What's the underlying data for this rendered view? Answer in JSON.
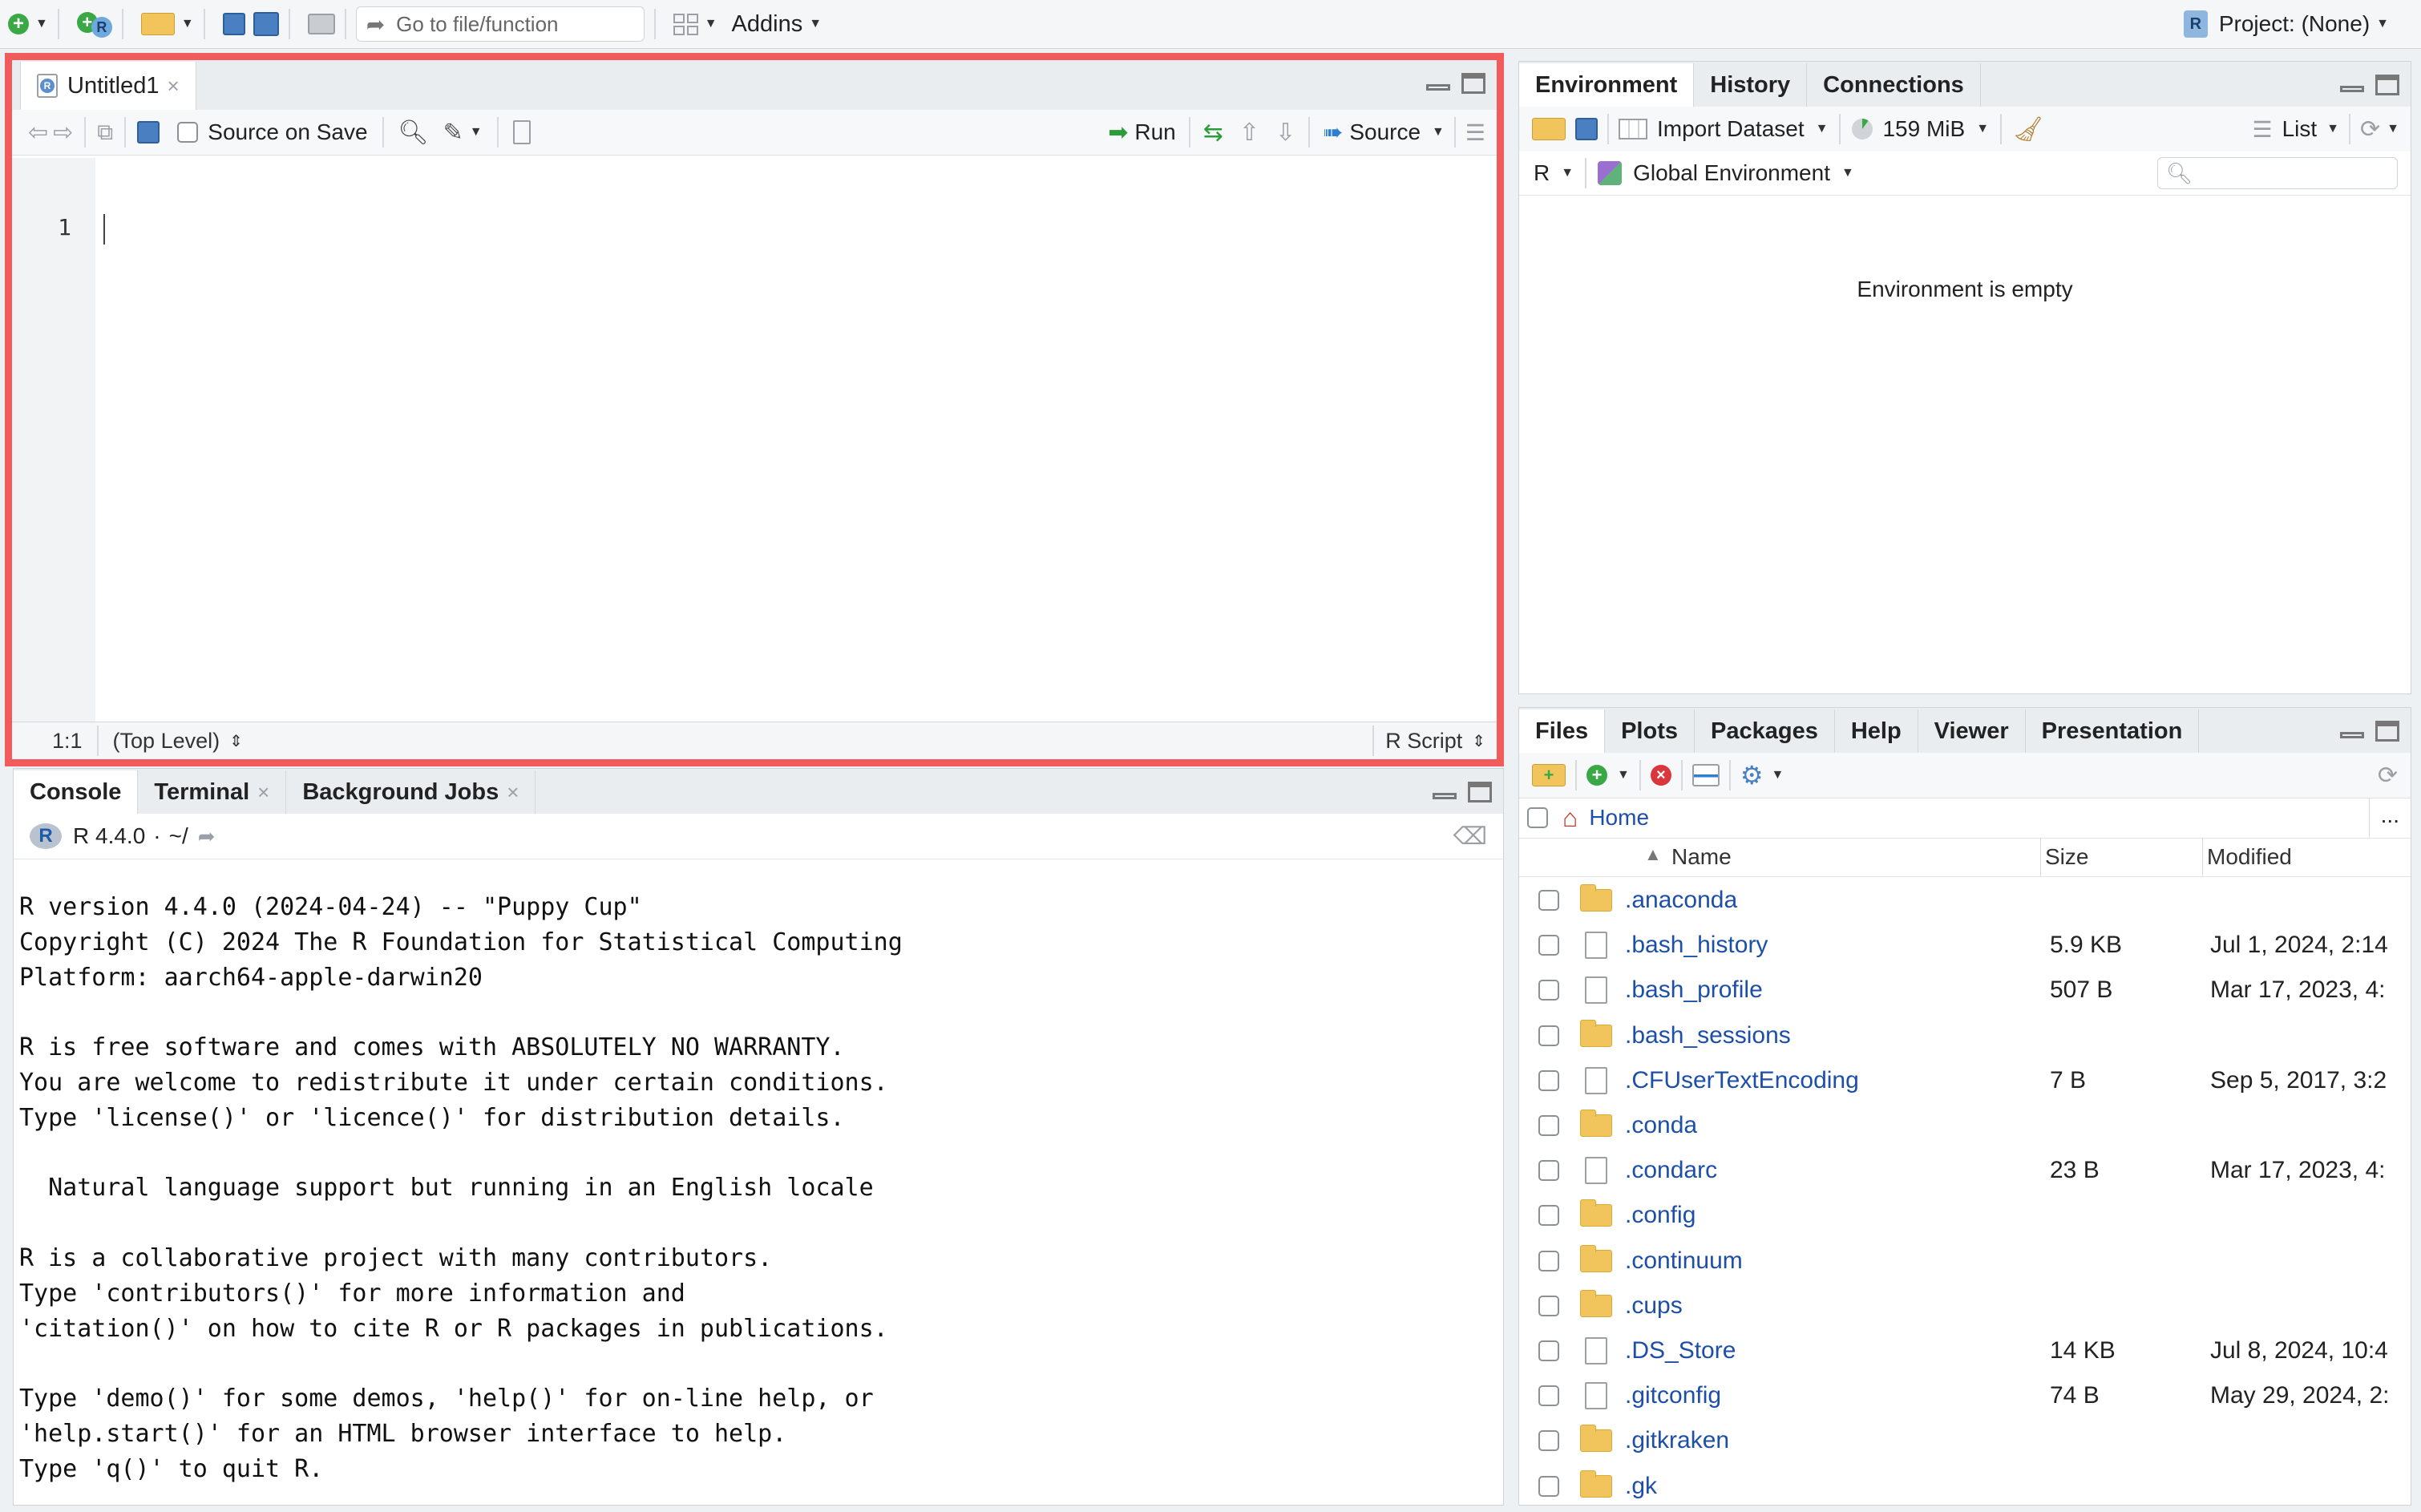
{
  "toolbar": {
    "goto_placeholder": "Go to file/function",
    "addins_label": "Addins",
    "project_label": "Project: (None)"
  },
  "editor": {
    "tab_label": "Untitled1",
    "source_on_save": "Source on Save",
    "run_label": "Run",
    "source_label": "Source",
    "line_number": "1",
    "cursor_pos": "1:1",
    "scope": "(Top Level)",
    "file_type": "R Script"
  },
  "console": {
    "tabs": [
      "Console",
      "Terminal",
      "Background Jobs"
    ],
    "r_version_label": "R 4.4.0",
    "path_label": "~/",
    "lines": [
      "R version 4.4.0 (2024-04-24) -- \"Puppy Cup\"",
      "Copyright (C) 2024 The R Foundation for Statistical Computing",
      "Platform: aarch64-apple-darwin20",
      "",
      "R is free software and comes with ABSOLUTELY NO WARRANTY.",
      "You are welcome to redistribute it under certain conditions.",
      "Type 'license()' or 'licence()' for distribution details.",
      "",
      "  Natural language support but running in an English locale",
      "",
      "R is a collaborative project with many contributors.",
      "Type 'contributors()' for more information and",
      "'citation()' on how to cite R or R packages in publications.",
      "",
      "Type 'demo()' for some demos, 'help()' for on-line help, or",
      "'help.start()' for an HTML browser interface to help.",
      "Type 'q()' to quit R."
    ]
  },
  "environment": {
    "tabs": [
      "Environment",
      "History",
      "Connections"
    ],
    "import_dataset": "Import Dataset",
    "memory": "159 MiB",
    "view_mode": "List",
    "language": "R",
    "scope": "Global Environment",
    "empty_message": "Environment is empty"
  },
  "files": {
    "tabs": [
      "Files",
      "Plots",
      "Packages",
      "Help",
      "Viewer",
      "Presentation"
    ],
    "breadcrumb": "Home",
    "more": "...",
    "columns": {
      "name": "Name",
      "size": "Size",
      "modified": "Modified"
    },
    "rows": [
      {
        "name": ".anaconda",
        "type": "folder",
        "size": "",
        "modified": ""
      },
      {
        "name": ".bash_history",
        "type": "file",
        "size": "5.9 KB",
        "modified": "Jul 1, 2024, 2:14"
      },
      {
        "name": ".bash_profile",
        "type": "file",
        "size": "507 B",
        "modified": "Mar 17, 2023, 4:"
      },
      {
        "name": ".bash_sessions",
        "type": "folder",
        "size": "",
        "modified": ""
      },
      {
        "name": ".CFUserTextEncoding",
        "type": "file",
        "size": "7 B",
        "modified": "Sep 5, 2017, 3:2"
      },
      {
        "name": ".conda",
        "type": "folder",
        "size": "",
        "modified": ""
      },
      {
        "name": ".condarc",
        "type": "file",
        "size": "23 B",
        "modified": "Mar 17, 2023, 4:"
      },
      {
        "name": ".config",
        "type": "folder",
        "size": "",
        "modified": ""
      },
      {
        "name": ".continuum",
        "type": "folder",
        "size": "",
        "modified": ""
      },
      {
        "name": ".cups",
        "type": "folder",
        "size": "",
        "modified": ""
      },
      {
        "name": ".DS_Store",
        "type": "file",
        "size": "14 KB",
        "modified": "Jul 8, 2024, 10:4"
      },
      {
        "name": ".gitconfig",
        "type": "file",
        "size": "74 B",
        "modified": "May 29, 2024, 2:"
      },
      {
        "name": ".gitkraken",
        "type": "folder",
        "size": "",
        "modified": ""
      },
      {
        "name": ".gk",
        "type": "folder",
        "size": "",
        "modified": ""
      }
    ]
  }
}
